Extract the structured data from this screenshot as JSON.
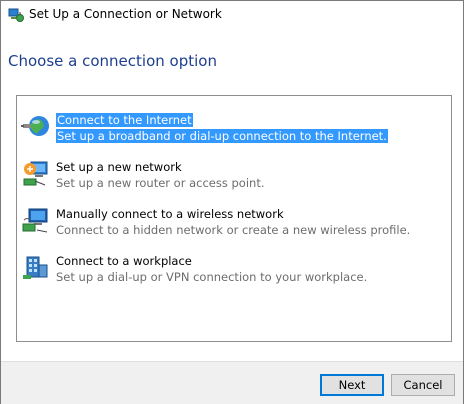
{
  "window": {
    "title": "Set Up a Connection or Network",
    "icon": "network-setup-icon"
  },
  "heading": "Choose a connection option",
  "options": [
    {
      "title": "Connect to the Internet",
      "description": "Set up a broadband or dial-up connection to the Internet.",
      "icon": "internet-globe-icon",
      "selected": true
    },
    {
      "title": "Set up a new network",
      "description": "Set up a new router or access point.",
      "icon": "new-network-icon",
      "selected": false
    },
    {
      "title": "Manually connect to a wireless network",
      "description": "Connect to a hidden network or create a new wireless profile.",
      "icon": "wireless-network-icon",
      "selected": false
    },
    {
      "title": "Connect to a workplace",
      "description": "Set up a dial-up or VPN connection to your workplace.",
      "icon": "workplace-vpn-icon",
      "selected": false
    }
  ],
  "buttons": {
    "next": "Next",
    "cancel": "Cancel"
  },
  "colors": {
    "heading": "#1e3f8f",
    "selection": "#3399ff",
    "default_button_border": "#0078d7"
  }
}
